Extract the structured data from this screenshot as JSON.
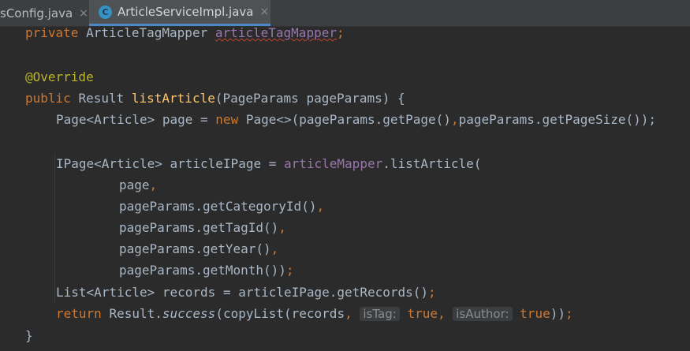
{
  "tabs": [
    {
      "label": "sConfig.java",
      "close": "×",
      "icon": "none"
    },
    {
      "label": "ArticleServiceImpl.java",
      "close": "×",
      "icon": "C"
    }
  ],
  "code": {
    "l1": {
      "kw": "private",
      "type": "ArticleTagMapper",
      "field": "articleTagMapper",
      "semi": ";"
    },
    "l3": {
      "ann": "@Override"
    },
    "l4": {
      "kw": "public",
      "type": "Result",
      "fn": "listArticle",
      "rest": "(PageParams pageParams) {"
    },
    "l5": {
      "a": "Page<Article> page = ",
      "kw": "new",
      "b": "Page<>(pageParams.getPage()",
      "comma": ",",
      "c": "pageParams.getPageSize());"
    },
    "l7": {
      "a": "IPage<Article> articleIPage = ",
      "field": "articleMapper",
      "b": ".listArticle("
    },
    "l8": {
      "a": "page",
      "comma": ","
    },
    "l9": {
      "a": "pageParams.getCategoryId()",
      "comma": ","
    },
    "l10": {
      "a": "pageParams.getTagId()",
      "comma": ","
    },
    "l11": {
      "a": "pageParams.getYear()",
      "comma": ","
    },
    "l12": {
      "a": "pageParams.getMonth())",
      "semi": ";"
    },
    "l13": {
      "a": "List<Article> records = articleIPage.getRecords()",
      "semi": ";"
    },
    "l14": {
      "kw": "return",
      "a": "Result.",
      "it": "success",
      "b": "(copyList(records",
      "comma1": ",",
      "hint1": "isTag:",
      "kw2": "true",
      "comma2": ",",
      "hint2": "isAuthor:",
      "kw3": "true",
      "c": "))",
      "semi": ";"
    },
    "l15": {
      "a": "}"
    }
  }
}
